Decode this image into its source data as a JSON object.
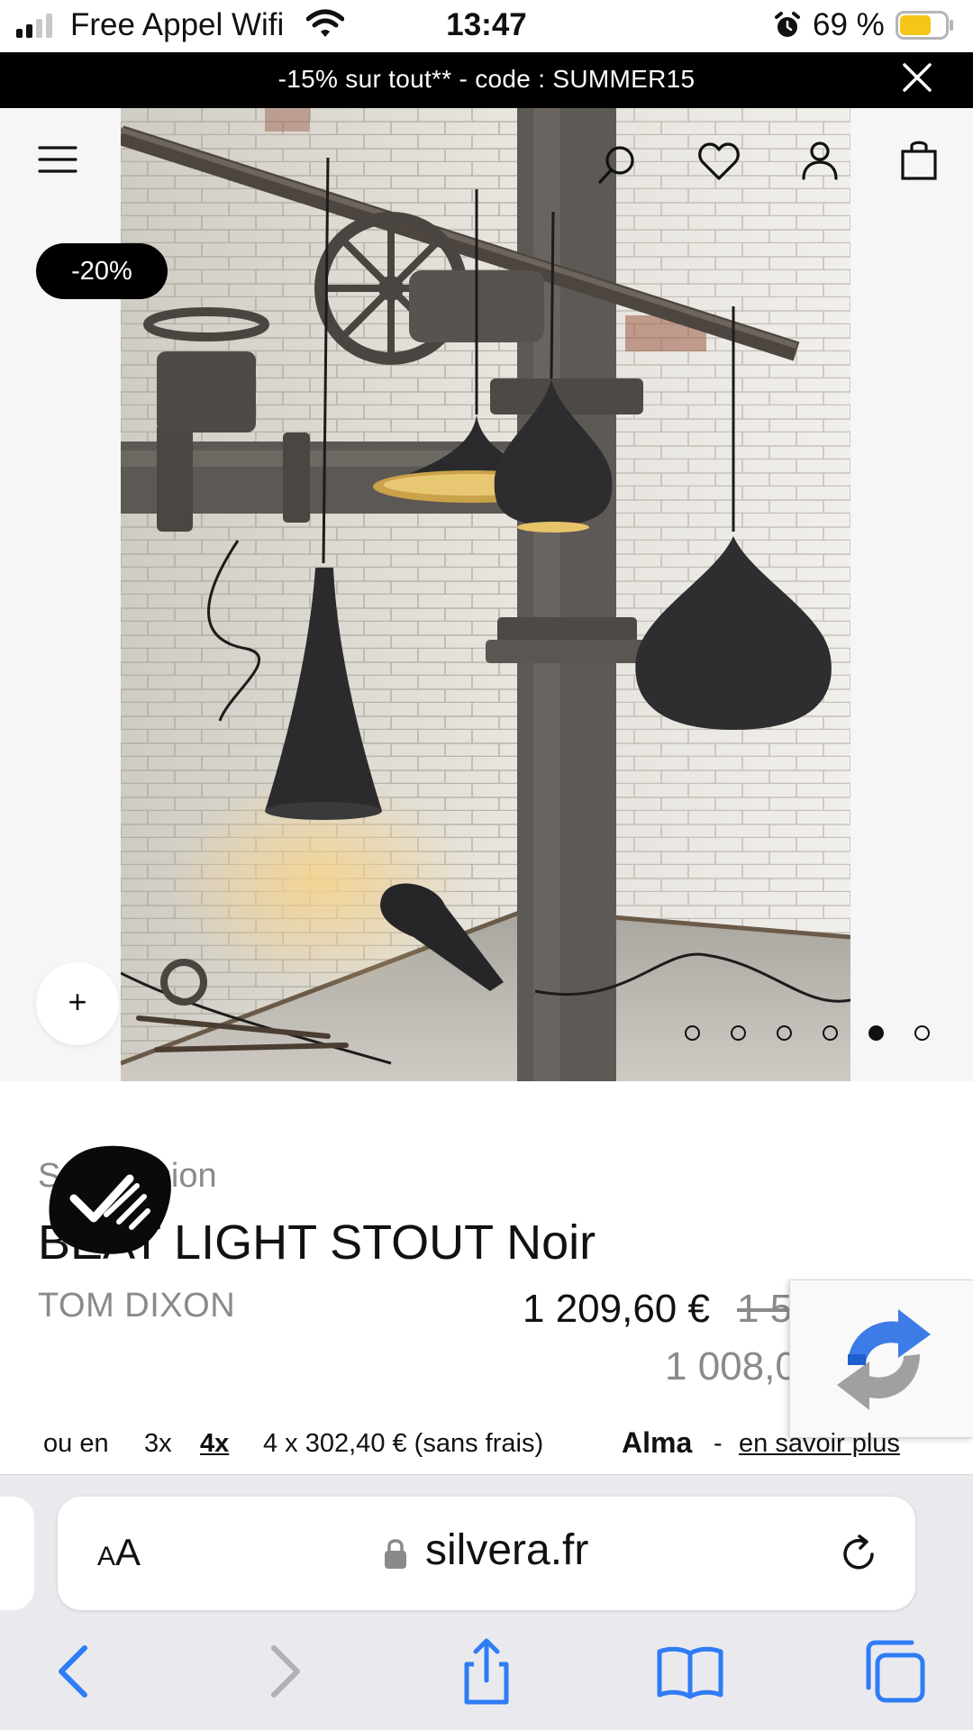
{
  "status_bar": {
    "carrier": "Free Appel Wifi",
    "time": "13:47",
    "battery_percent": "69 %",
    "signal_bars_on": 2,
    "signal_bars_total": 4,
    "battery_level": 0.69,
    "battery_color": "#f5c518"
  },
  "promo": {
    "text": "-15% sur tout** - code : SUMMER15",
    "close_icon": "close-icon"
  },
  "header": {
    "menu_icon": "hamburger-menu-icon",
    "search_icon": "search-icon",
    "wishlist_icon": "heart-icon",
    "account_icon": "user-icon",
    "cart_icon": "shopping-bag-icon"
  },
  "hero": {
    "discount_badge": "-20%",
    "zoom_label": "+",
    "image_count": 6,
    "active_image": 5,
    "image_subject": "black Beat Light pendant lamps in industrial brick room"
  },
  "product": {
    "category": "Suspension",
    "name": "BEAT LIGHT STOUT Noir",
    "brand": "TOM DIXON",
    "price_now": "1 209,60 €",
    "price_old": "1 5",
    "price_ht": "1 008,0"
  },
  "installments": {
    "prefix": "ou en",
    "option_3x": "3x",
    "option_4x": "4x",
    "detail": "4 x 302,40 € (sans frais)",
    "provider": "Alma",
    "separator": "-",
    "learn_more": "en savoir plus"
  },
  "browser": {
    "text_size_small": "A",
    "text_size_large": "A",
    "url": "silvera.fr",
    "lock_icon": "lock-icon",
    "reload_icon": "reload-icon",
    "toolbar": [
      "back-icon",
      "forward-icon",
      "share-icon",
      "bookmarks-icon",
      "tabs-icon"
    ],
    "accent_color": "#2f7cf6"
  },
  "colors": {
    "banner": "#000000",
    "muted_text": "#8a8a8a"
  }
}
